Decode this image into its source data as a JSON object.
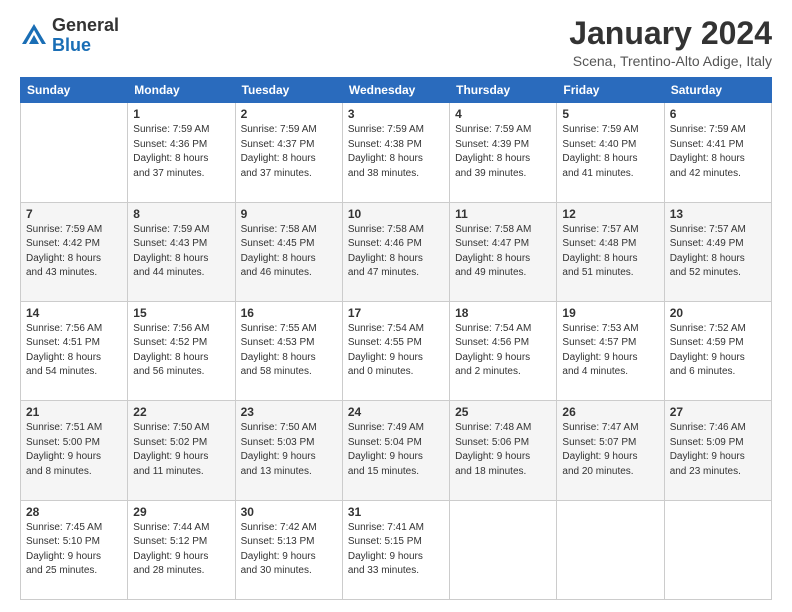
{
  "header": {
    "logo_line1": "General",
    "logo_line2": "Blue",
    "month_title": "January 2024",
    "location": "Scena, Trentino-Alto Adige, Italy"
  },
  "days_of_week": [
    "Sunday",
    "Monday",
    "Tuesday",
    "Wednesday",
    "Thursday",
    "Friday",
    "Saturday"
  ],
  "weeks": [
    [
      {
        "num": "",
        "info": ""
      },
      {
        "num": "1",
        "info": "Sunrise: 7:59 AM\nSunset: 4:36 PM\nDaylight: 8 hours\nand 37 minutes."
      },
      {
        "num": "2",
        "info": "Sunrise: 7:59 AM\nSunset: 4:37 PM\nDaylight: 8 hours\nand 37 minutes."
      },
      {
        "num": "3",
        "info": "Sunrise: 7:59 AM\nSunset: 4:38 PM\nDaylight: 8 hours\nand 38 minutes."
      },
      {
        "num": "4",
        "info": "Sunrise: 7:59 AM\nSunset: 4:39 PM\nDaylight: 8 hours\nand 39 minutes."
      },
      {
        "num": "5",
        "info": "Sunrise: 7:59 AM\nSunset: 4:40 PM\nDaylight: 8 hours\nand 41 minutes."
      },
      {
        "num": "6",
        "info": "Sunrise: 7:59 AM\nSunset: 4:41 PM\nDaylight: 8 hours\nand 42 minutes."
      }
    ],
    [
      {
        "num": "7",
        "info": "Sunrise: 7:59 AM\nSunset: 4:42 PM\nDaylight: 8 hours\nand 43 minutes."
      },
      {
        "num": "8",
        "info": "Sunrise: 7:59 AM\nSunset: 4:43 PM\nDaylight: 8 hours\nand 44 minutes."
      },
      {
        "num": "9",
        "info": "Sunrise: 7:58 AM\nSunset: 4:45 PM\nDaylight: 8 hours\nand 46 minutes."
      },
      {
        "num": "10",
        "info": "Sunrise: 7:58 AM\nSunset: 4:46 PM\nDaylight: 8 hours\nand 47 minutes."
      },
      {
        "num": "11",
        "info": "Sunrise: 7:58 AM\nSunset: 4:47 PM\nDaylight: 8 hours\nand 49 minutes."
      },
      {
        "num": "12",
        "info": "Sunrise: 7:57 AM\nSunset: 4:48 PM\nDaylight: 8 hours\nand 51 minutes."
      },
      {
        "num": "13",
        "info": "Sunrise: 7:57 AM\nSunset: 4:49 PM\nDaylight: 8 hours\nand 52 minutes."
      }
    ],
    [
      {
        "num": "14",
        "info": "Sunrise: 7:56 AM\nSunset: 4:51 PM\nDaylight: 8 hours\nand 54 minutes."
      },
      {
        "num": "15",
        "info": "Sunrise: 7:56 AM\nSunset: 4:52 PM\nDaylight: 8 hours\nand 56 minutes."
      },
      {
        "num": "16",
        "info": "Sunrise: 7:55 AM\nSunset: 4:53 PM\nDaylight: 8 hours\nand 58 minutes."
      },
      {
        "num": "17",
        "info": "Sunrise: 7:54 AM\nSunset: 4:55 PM\nDaylight: 9 hours\nand 0 minutes."
      },
      {
        "num": "18",
        "info": "Sunrise: 7:54 AM\nSunset: 4:56 PM\nDaylight: 9 hours\nand 2 minutes."
      },
      {
        "num": "19",
        "info": "Sunrise: 7:53 AM\nSunset: 4:57 PM\nDaylight: 9 hours\nand 4 minutes."
      },
      {
        "num": "20",
        "info": "Sunrise: 7:52 AM\nSunset: 4:59 PM\nDaylight: 9 hours\nand 6 minutes."
      }
    ],
    [
      {
        "num": "21",
        "info": "Sunrise: 7:51 AM\nSunset: 5:00 PM\nDaylight: 9 hours\nand 8 minutes."
      },
      {
        "num": "22",
        "info": "Sunrise: 7:50 AM\nSunset: 5:02 PM\nDaylight: 9 hours\nand 11 minutes."
      },
      {
        "num": "23",
        "info": "Sunrise: 7:50 AM\nSunset: 5:03 PM\nDaylight: 9 hours\nand 13 minutes."
      },
      {
        "num": "24",
        "info": "Sunrise: 7:49 AM\nSunset: 5:04 PM\nDaylight: 9 hours\nand 15 minutes."
      },
      {
        "num": "25",
        "info": "Sunrise: 7:48 AM\nSunset: 5:06 PM\nDaylight: 9 hours\nand 18 minutes."
      },
      {
        "num": "26",
        "info": "Sunrise: 7:47 AM\nSunset: 5:07 PM\nDaylight: 9 hours\nand 20 minutes."
      },
      {
        "num": "27",
        "info": "Sunrise: 7:46 AM\nSunset: 5:09 PM\nDaylight: 9 hours\nand 23 minutes."
      }
    ],
    [
      {
        "num": "28",
        "info": "Sunrise: 7:45 AM\nSunset: 5:10 PM\nDaylight: 9 hours\nand 25 minutes."
      },
      {
        "num": "29",
        "info": "Sunrise: 7:44 AM\nSunset: 5:12 PM\nDaylight: 9 hours\nand 28 minutes."
      },
      {
        "num": "30",
        "info": "Sunrise: 7:42 AM\nSunset: 5:13 PM\nDaylight: 9 hours\nand 30 minutes."
      },
      {
        "num": "31",
        "info": "Sunrise: 7:41 AM\nSunset: 5:15 PM\nDaylight: 9 hours\nand 33 minutes."
      },
      {
        "num": "",
        "info": ""
      },
      {
        "num": "",
        "info": ""
      },
      {
        "num": "",
        "info": ""
      }
    ]
  ]
}
